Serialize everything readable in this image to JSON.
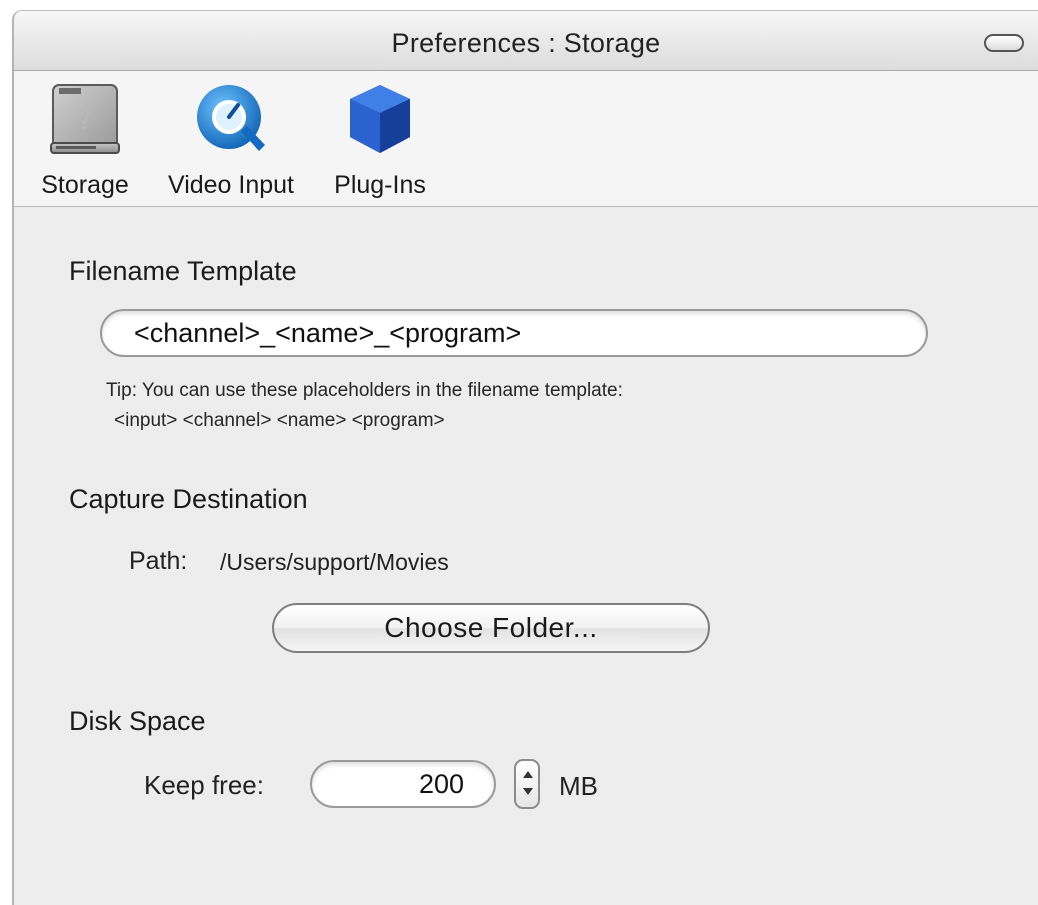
{
  "window": {
    "title": "Preferences : Storage"
  },
  "toolbar": {
    "items": [
      {
        "label": "Storage",
        "icon": "hard-drive-icon"
      },
      {
        "label": "Video Input",
        "icon": "quicktime-icon"
      },
      {
        "label": "Plug-Ins",
        "icon": "cube-icon"
      }
    ],
    "selected": "Storage"
  },
  "filename_template": {
    "heading": "Filename Template",
    "value": "<channel>_<name>_<program>",
    "tip_line1": "Tip: You can use these placeholders in the filename template:",
    "tip_line2": "<input> <channel> <name> <program>"
  },
  "capture_destination": {
    "heading": "Capture Destination",
    "path_label": "Path:",
    "path_value": "/Users/support/Movies",
    "choose_button": "Choose Folder..."
  },
  "disk_space": {
    "heading": "Disk Space",
    "keep_free_label": "Keep free:",
    "keep_free_value": "200",
    "unit": "MB"
  },
  "colors": {
    "window_bg": "#ededed",
    "toolbar_bg": "#f5f5f5",
    "cube_blue": "#1f56c8",
    "quicktime_blue": "#1f86d6"
  }
}
